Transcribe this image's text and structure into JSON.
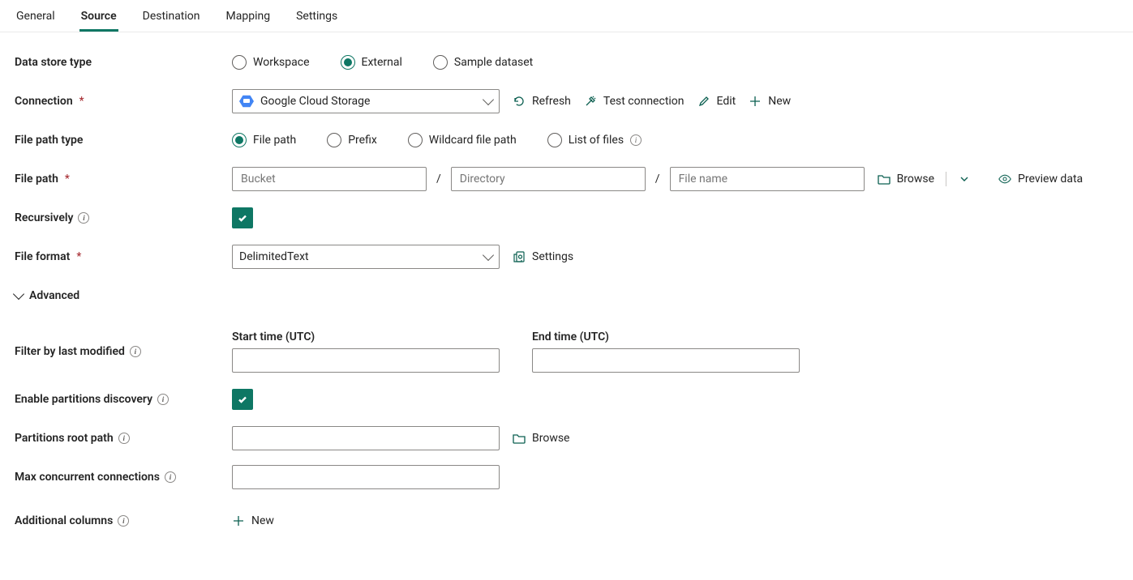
{
  "tabs": {
    "general": "General",
    "source": "Source",
    "destination": "Destination",
    "mapping": "Mapping",
    "settings": "Settings",
    "active": "source"
  },
  "labels": {
    "data_store_type": "Data store type",
    "connection": "Connection",
    "file_path_type": "File path type",
    "file_path": "File path",
    "recursively": "Recursively",
    "file_format": "File format",
    "advanced": "Advanced",
    "filter_by_last_modified": "Filter by last modified",
    "enable_partitions_discovery": "Enable partitions discovery",
    "partitions_root_path": "Partitions root path",
    "max_concurrent_connections": "Max concurrent connections",
    "additional_columns": "Additional columns",
    "start_time": "Start time (UTC)",
    "end_time": "End time (UTC)"
  },
  "data_store_type": {
    "workspace": "Workspace",
    "external": "External",
    "sample": "Sample dataset",
    "selected": "external"
  },
  "connection": {
    "selected": "Google Cloud Storage",
    "actions": {
      "refresh": "Refresh",
      "test": "Test connection",
      "edit": "Edit",
      "new": "New"
    }
  },
  "file_path_type": {
    "file_path": "File path",
    "prefix": "Prefix",
    "wildcard": "Wildcard file path",
    "list": "List of files",
    "selected": "file_path"
  },
  "file_path": {
    "bucket_placeholder": "Bucket",
    "directory_placeholder": "Directory",
    "file_placeholder": "File name",
    "browse": "Browse",
    "preview": "Preview data"
  },
  "recursively_checked": true,
  "file_format": {
    "selected": "DelimitedText",
    "settings_label": "Settings"
  },
  "enable_partitions_discovery_checked": true,
  "partitions": {
    "browse": "Browse"
  },
  "additional_columns": {
    "new": "New"
  }
}
